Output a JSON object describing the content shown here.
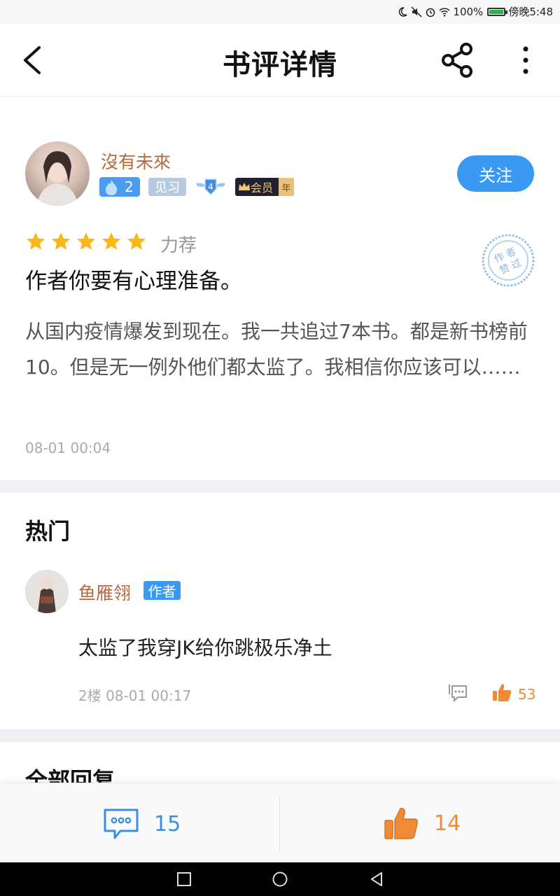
{
  "status_bar": {
    "battery": "100%",
    "time": "傍晚5:48"
  },
  "header": {
    "title": "书评详情"
  },
  "review": {
    "user": {
      "name": "沒有未來",
      "fire_level": "2",
      "rank_badge": "见习",
      "wing_level": "4",
      "vip_label": "会员",
      "vip_suffix": "年"
    },
    "follow_label": "关注",
    "rating_stars": 5,
    "rating_label": "力荐",
    "stamp_text": "作者赞过",
    "title": "作者你要有心理准备。",
    "body": "从国内疫情爆发到现在。我一共追过7本书。都是新书榜前10。但是无一例外他们都太监了。我相信你应该可以……",
    "time": "08-01 00:04"
  },
  "hot": {
    "section_title": "热门",
    "comments": [
      {
        "name": "鱼雁翎",
        "tag": "作者",
        "text": "太监了我穿JK给你跳极乐净土",
        "meta": "2楼 08-01 00:17",
        "likes": "53"
      }
    ]
  },
  "all_replies": {
    "section_title": "全部回复"
  },
  "action_bar": {
    "comment_count": "15",
    "like_count": "14"
  },
  "colors": {
    "accent_blue": "#3a9af3",
    "username_brown": "#b5693e",
    "like_orange": "#ef8b35",
    "star_yellow": "#f8b81c"
  }
}
